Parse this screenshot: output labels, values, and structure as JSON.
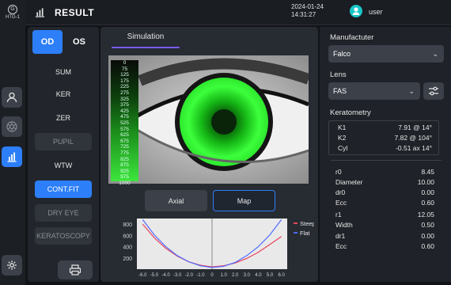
{
  "device": {
    "name": "HTG-1",
    "logo_glyph": "G"
  },
  "header": {
    "title": "RESULT",
    "date": "2024-01-24",
    "time": "14:31:27",
    "user": "user"
  },
  "eye_select": {
    "od": "OD",
    "os": "OS",
    "selected": "OD"
  },
  "menu": [
    {
      "label": "SUM",
      "state": "normal"
    },
    {
      "label": "KER",
      "state": "normal"
    },
    {
      "label": "ZER",
      "state": "normal"
    },
    {
      "label": "PUPIL",
      "state": "disabled"
    },
    {
      "label": "WTW",
      "state": "normal"
    },
    {
      "label": "CONT.FIT",
      "state": "active"
    },
    {
      "label": "DRY EYE",
      "state": "disabled"
    },
    {
      "label": "KERATOSCOPY",
      "state": "disabled"
    }
  ],
  "center": {
    "tab": "Simulation",
    "scale": [
      "0",
      "75",
      "125",
      "175",
      "225",
      "275",
      "325",
      "375",
      "425",
      "475",
      "525",
      "575",
      "625",
      "675",
      "725",
      "775",
      "825",
      "875",
      "925",
      "975",
      "1000"
    ],
    "buttons": {
      "axial": "Axial",
      "map": "Map"
    }
  },
  "chart_data": {
    "type": "line",
    "x_ticks": [
      "-6.0",
      "-5.0",
      "-4.0",
      "-3.0",
      "-2.0",
      "-1.0",
      "0",
      "1.0",
      "2.0",
      "3.0",
      "4.0",
      "5.0",
      "6.0"
    ],
    "y_ticks": [
      "800",
      "600",
      "400",
      "200"
    ],
    "ylim": [
      0,
      900
    ],
    "xlim": [
      -6.5,
      6.5
    ],
    "series": [
      {
        "name": "Steep",
        "color": "#e8435a",
        "x": [
          -6,
          -5,
          -4,
          -3,
          -2,
          -1,
          0,
          1,
          2,
          3,
          4,
          5,
          6
        ],
        "y": [
          800,
          560,
          370,
          230,
          130,
          70,
          40,
          60,
          110,
          190,
          300,
          440,
          580
        ]
      },
      {
        "name": "Flat",
        "color": "#4f6bff",
        "x": [
          -6,
          -5,
          -4,
          -3,
          -2,
          -1,
          0,
          1,
          2,
          3,
          4,
          5,
          6
        ],
        "y": [
          880,
          610,
          400,
          240,
          130,
          60,
          30,
          50,
          120,
          240,
          400,
          610,
          880
        ]
      }
    ]
  },
  "right": {
    "manufacturer_label": "Manufactuter",
    "manufacturer_value": "Falco",
    "lens_label": "Lens",
    "lens_value": "FAS",
    "keratometry_label": "Keratometry",
    "k1_label": "K1",
    "k1_value": "7.91 @ 14°",
    "k2_label": "K2",
    "k2_value": "7.82 @ 104°",
    "cyl_label": "Cyl",
    "cyl_value": "-0.51 ax 14°",
    "params": [
      {
        "label": "r0",
        "value": "8.45"
      },
      {
        "label": "Diameter",
        "value": "10.00"
      },
      {
        "label": "dr0",
        "value": "0.00"
      },
      {
        "label": "Ecc",
        "value": "0.60"
      },
      {
        "label": "r1",
        "value": "12.05"
      },
      {
        "label": "Width",
        "value": "0.50"
      },
      {
        "label": "dr1",
        "value": "0.00"
      },
      {
        "label": "Ecc",
        "value": "0.60"
      }
    ]
  }
}
